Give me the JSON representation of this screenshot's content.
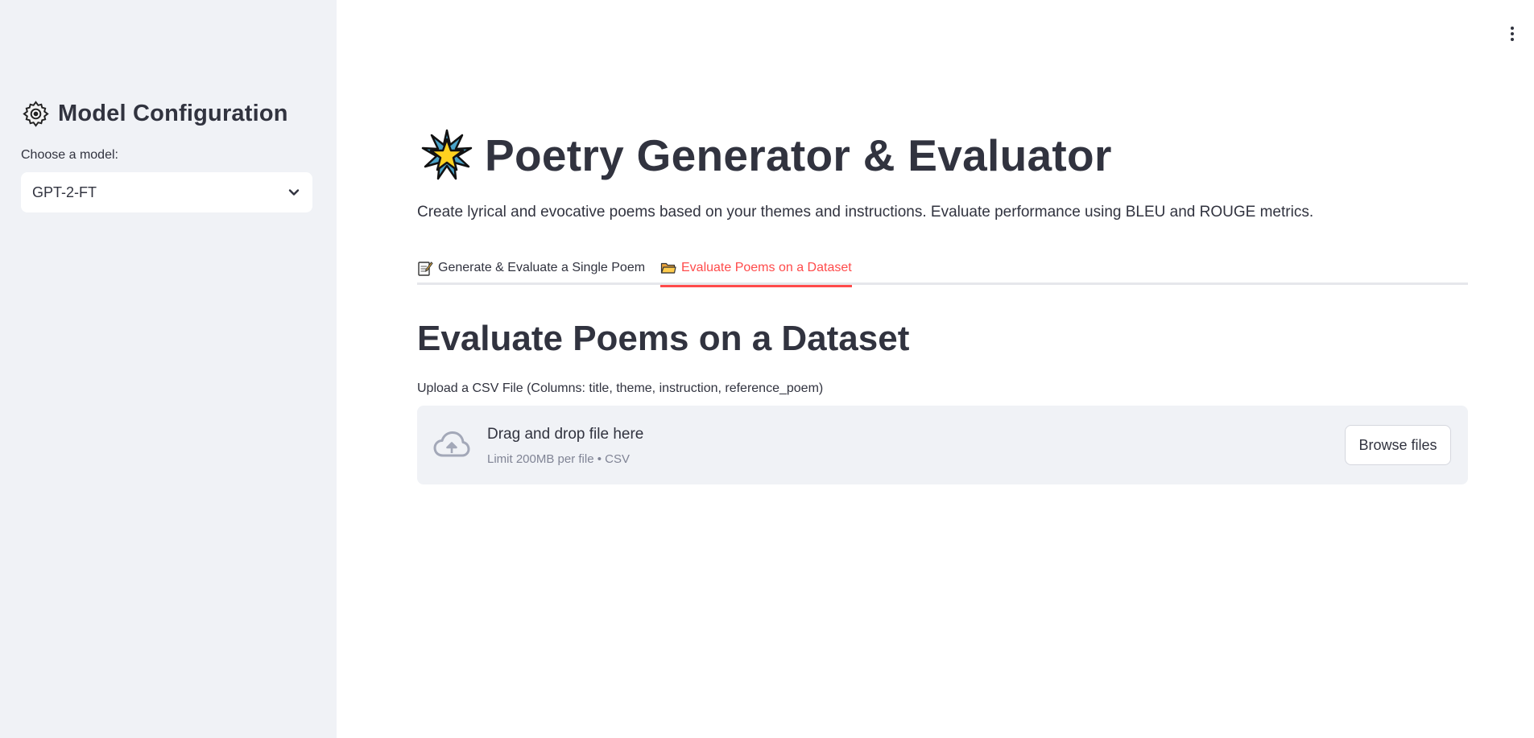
{
  "sidebar": {
    "title": "Model Configuration",
    "title_icon": "gear-icon",
    "model_label": "Choose a model:",
    "model_selected": "GPT-2-FT"
  },
  "header": {
    "icon": "star-icon",
    "title": "Poetry Generator & Evaluator",
    "subtitle": "Create lyrical and evocative poems based on your themes and instructions. Evaluate performance using BLEU and ROUGE metrics."
  },
  "tabs": [
    {
      "label": "Generate & Evaluate a Single Poem",
      "icon": "memo-icon",
      "active": false
    },
    {
      "label": "Evaluate Poems on a Dataset",
      "icon": "folder-icon",
      "active": true
    }
  ],
  "main": {
    "section_heading": "Evaluate Poems on a Dataset",
    "upload_label": "Upload a CSV File (Columns: title, theme, instruction, reference_poem)",
    "dropzone": {
      "icon": "cloud-upload-icon",
      "text": "Drag and drop file here",
      "limit": "Limit 200MB per file • CSV",
      "button_label": "Browse files"
    }
  },
  "colors": {
    "accent": "#ff4b4b",
    "sidebar_bg": "#f0f2f6",
    "text": "#31333f",
    "muted": "#808495"
  }
}
